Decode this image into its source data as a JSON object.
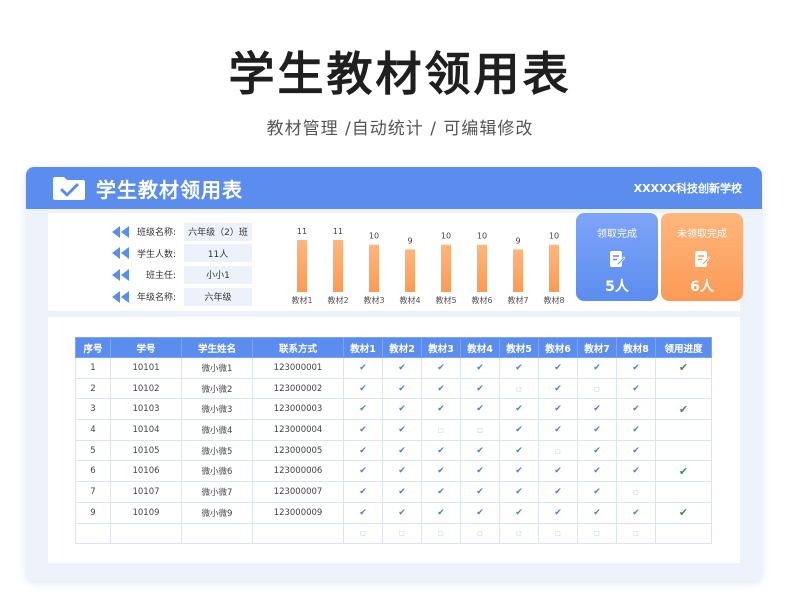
{
  "page": {
    "title": "学生教材领用表",
    "subtitle": "教材管理 /自动统计 /  可编辑修改"
  },
  "header": {
    "title": "学生教材领用表",
    "school": "XXXXX科技创新学校"
  },
  "info": [
    {
      "label": "班级名称:",
      "value": "六年级（2）班"
    },
    {
      "label": "学生人数:",
      "value": "11人"
    },
    {
      "label": "班主任:",
      "value": "小小1"
    },
    {
      "label": "年级名称:",
      "value": "六年级"
    }
  ],
  "chart_data": {
    "type": "bar",
    "categories": [
      "教材1",
      "教材2",
      "教材3",
      "教材4",
      "教材5",
      "教材6",
      "教材7",
      "教材8"
    ],
    "values": [
      11,
      11,
      10,
      9,
      10,
      10,
      9,
      10
    ],
    "ylim": [
      0,
      11
    ],
    "colors": {
      "bar_top": "#ffb67d",
      "bar_bottom": "#fb9a55"
    }
  },
  "stats": {
    "done": {
      "label": "领取完成",
      "value": "5人"
    },
    "undone": {
      "label": "未领取完成",
      "value": "6人"
    }
  },
  "table": {
    "headers": [
      "序号",
      "学号",
      "学生姓名",
      "联系方式",
      "教材1",
      "教材2",
      "教材3",
      "教材4",
      "教材5",
      "教材6",
      "教材7",
      "教材8",
      "领用进度"
    ],
    "rows": [
      {
        "no": "1",
        "id": "10101",
        "name": "微小微1",
        "phone": "123000001",
        "marks": [
          1,
          1,
          1,
          1,
          1,
          1,
          1,
          1
        ],
        "done": true
      },
      {
        "no": "2",
        "id": "10102",
        "name": "微小微2",
        "phone": "123000002",
        "marks": [
          1,
          1,
          1,
          1,
          0,
          1,
          0,
          1
        ],
        "done": false
      },
      {
        "no": "3",
        "id": "10103",
        "name": "微小微3",
        "phone": "123000003",
        "marks": [
          1,
          1,
          1,
          1,
          1,
          1,
          1,
          1
        ],
        "done": true
      },
      {
        "no": "4",
        "id": "10104",
        "name": "微小微4",
        "phone": "123000004",
        "marks": [
          1,
          1,
          0,
          0,
          1,
          1,
          1,
          1
        ],
        "done": false
      },
      {
        "no": "5",
        "id": "10105",
        "name": "微小微5",
        "phone": "123000005",
        "marks": [
          1,
          1,
          1,
          1,
          1,
          0,
          1,
          1
        ],
        "done": false
      },
      {
        "no": "6",
        "id": "10106",
        "name": "微小微6",
        "phone": "123000006",
        "marks": [
          1,
          1,
          1,
          1,
          1,
          1,
          1,
          1
        ],
        "done": true
      },
      {
        "no": "7",
        "id": "10107",
        "name": "微小微7",
        "phone": "123000007",
        "marks": [
          1,
          1,
          1,
          1,
          1,
          1,
          1,
          0
        ],
        "done": false
      },
      {
        "no": "9",
        "id": "10109",
        "name": "微小微9",
        "phone": "123000009",
        "marks": [
          1,
          1,
          1,
          1,
          1,
          1,
          1,
          1
        ],
        "done": true
      },
      {
        "no": "",
        "id": "",
        "name": "",
        "phone": "",
        "marks": [
          0,
          0,
          0,
          0,
          0,
          0,
          0,
          0
        ],
        "done": false
      }
    ],
    "check_glyph": "✔",
    "empty_glyph": "□",
    "done_glyph": "✔"
  },
  "icons": {
    "header": "folder-check-icon",
    "arrow": "double-left-arrow-icon",
    "stat": "note-edit-icon"
  }
}
